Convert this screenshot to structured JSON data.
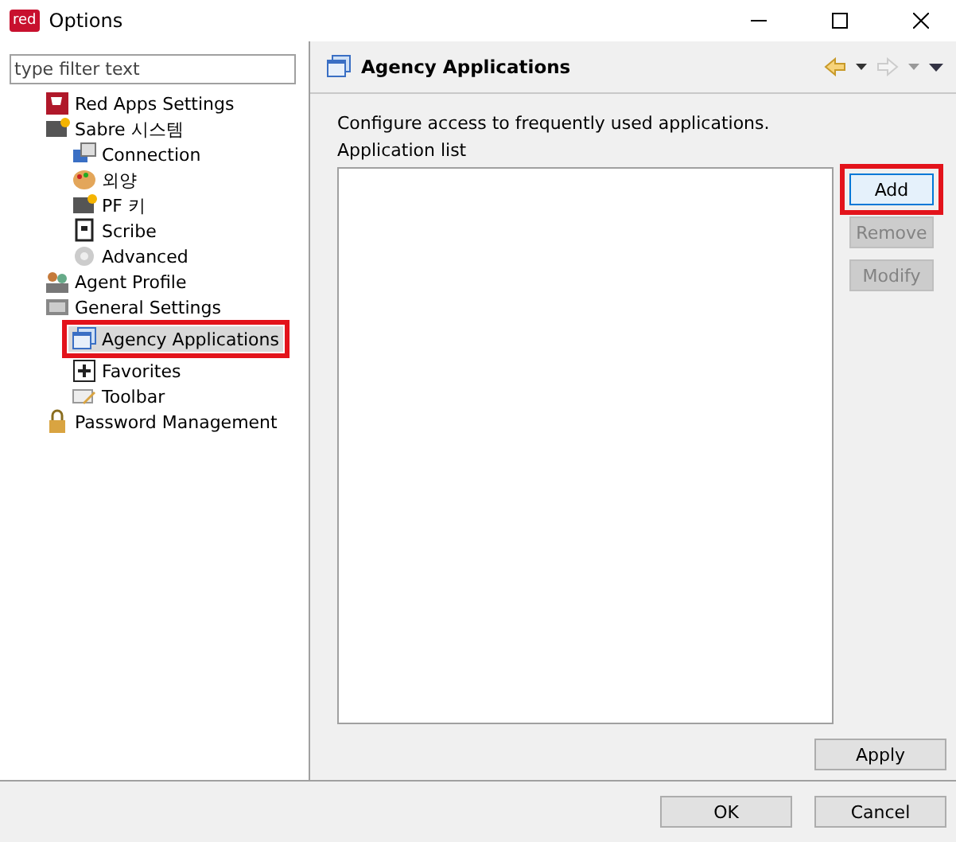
{
  "window": {
    "logo": "red",
    "title": "Options"
  },
  "filter": {
    "placeholder": "type filter text"
  },
  "tree": [
    {
      "label": "Red Apps Settings",
      "kind": "cart",
      "selected": false,
      "highlighted": false
    },
    {
      "label": "Sabre 시스템",
      "kind": "terminal",
      "selected": false,
      "highlighted": false,
      "children": [
        {
          "label": "Connection",
          "kind": "network",
          "selected": false,
          "highlighted": false
        },
        {
          "label": "외양",
          "kind": "palette",
          "selected": false,
          "highlighted": false
        },
        {
          "label": "PF 키",
          "kind": "terminal",
          "selected": false,
          "highlighted": false
        },
        {
          "label": "Scribe",
          "kind": "scroll",
          "selected": false,
          "highlighted": false
        },
        {
          "label": "Advanced",
          "kind": "gear",
          "selected": false,
          "highlighted": false
        }
      ]
    },
    {
      "label": "Agent Profile",
      "kind": "people",
      "selected": false,
      "highlighted": false
    },
    {
      "label": "General Settings",
      "kind": "keyboard",
      "selected": false,
      "highlighted": false,
      "children": [
        {
          "label": "Agency Applications",
          "kind": "windows",
          "selected": true,
          "highlighted": true
        },
        {
          "label": "Favorites",
          "kind": "plus",
          "selected": false,
          "highlighted": false
        },
        {
          "label": "Toolbar",
          "kind": "pencil",
          "selected": false,
          "highlighted": false
        }
      ]
    },
    {
      "label": "Password Management",
      "kind": "lock",
      "selected": false,
      "highlighted": false
    }
  ],
  "page": {
    "title": "Agency Applications",
    "description": "Configure access to frequently used applications.",
    "list_label": "Application list",
    "buttons": [
      {
        "label": "Add",
        "disabled": false,
        "highlighted": true
      },
      {
        "label": "Remove",
        "disabled": true,
        "highlighted": false
      },
      {
        "label": "Modify",
        "disabled": true,
        "highlighted": false
      }
    ],
    "apply": "Apply"
  },
  "footer": {
    "buttons": [
      "OK",
      "Cancel"
    ]
  }
}
